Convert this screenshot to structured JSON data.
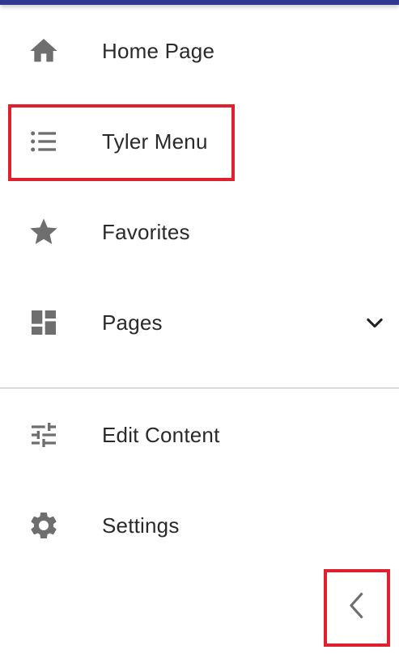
{
  "nav": {
    "items": [
      {
        "label": "Home Page",
        "icon": "home-icon"
      },
      {
        "label": "Tyler Menu",
        "icon": "list-icon"
      },
      {
        "label": "Favorites",
        "icon": "star-icon"
      },
      {
        "label": "Pages",
        "icon": "dashboard-icon",
        "expandable": true
      }
    ],
    "secondary_items": [
      {
        "label": "Edit Content",
        "icon": "tune-icon"
      },
      {
        "label": "Settings",
        "icon": "gear-icon"
      }
    ]
  },
  "colors": {
    "top_bar": "#2f3a8f",
    "icon": "#6e6e6e",
    "highlight": "#e0202c",
    "text": "#2a2a2a"
  },
  "collapse": {
    "icon": "chevron-left-icon"
  }
}
